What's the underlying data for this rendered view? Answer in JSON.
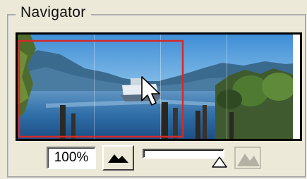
{
  "panel": {
    "title": "Navigator"
  },
  "preview": {
    "image": "lake-landscape-with-boat-thumbnail",
    "viewbox_color": "#d42a2a"
  },
  "controls": {
    "zoom_value": "100%",
    "zoom_out_icon": "small-mountains-icon",
    "zoom_in_icon": "large-mountains-icon",
    "zoom_slider_level": 0.94
  },
  "colors": {
    "panel_background": "#ece9d8",
    "view_box": "#d42a2a"
  }
}
